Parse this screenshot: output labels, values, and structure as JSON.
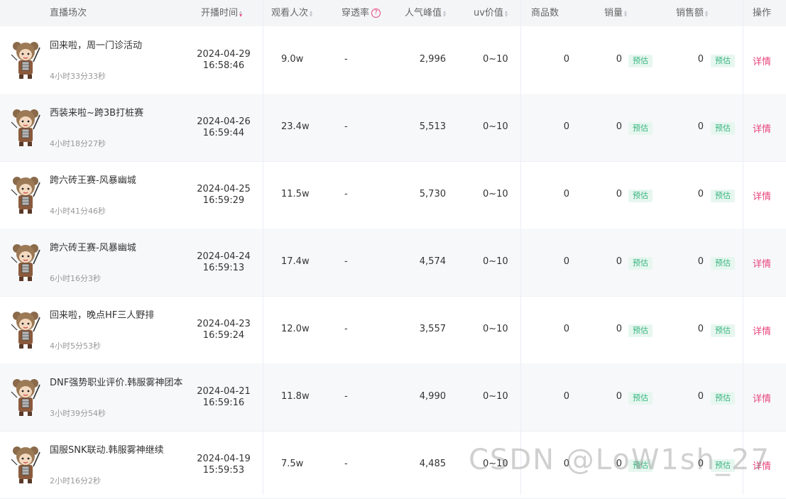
{
  "columns": {
    "session": "直播场次",
    "start_time": "开播时间",
    "viewers": "观看人次",
    "penetration": "穿透率",
    "peak": "人气峰值",
    "uv": "uv价值",
    "products": "商品数",
    "sales": "销量",
    "revenue": "销售额",
    "actions": "操作"
  },
  "help_glyph": "?",
  "estimate_label": "预估",
  "detail_label": "详情",
  "watermark": "CSDN @LoW1sh_27",
  "rows": [
    {
      "title": "回来啦，周一门诊活动",
      "duration": "4小时33分33秒",
      "date": "2024-04-29",
      "time": "16:58:46",
      "viewers": "9.0w",
      "penetration": "-",
      "peak": "2,996",
      "uv": "0~10",
      "products": "0",
      "sales": "0",
      "revenue": "0"
    },
    {
      "title": "西装来啦~跨3B打桩赛",
      "duration": "4小时18分27秒",
      "date": "2024-04-26",
      "time": "16:59:44",
      "viewers": "23.4w",
      "penetration": "-",
      "peak": "5,513",
      "uv": "0~10",
      "products": "0",
      "sales": "0",
      "revenue": "0"
    },
    {
      "title": "跨六砖王赛-风暴幽城",
      "duration": "4小时41分46秒",
      "date": "2024-04-25",
      "time": "16:59:29",
      "viewers": "11.5w",
      "penetration": "-",
      "peak": "5,730",
      "uv": "0~10",
      "products": "0",
      "sales": "0",
      "revenue": "0"
    },
    {
      "title": "跨六砖王赛-风暴幽城",
      "duration": "6小时16分3秒",
      "date": "2024-04-24",
      "time": "16:59:13",
      "viewers": "17.4w",
      "penetration": "-",
      "peak": "4,574",
      "uv": "0~10",
      "products": "0",
      "sales": "0",
      "revenue": "0"
    },
    {
      "title": "回来啦，晚点HF三人野排",
      "duration": "4小时5分53秒",
      "date": "2024-04-23",
      "time": "16:59:24",
      "viewers": "12.0w",
      "penetration": "-",
      "peak": "3,557",
      "uv": "0~10",
      "products": "0",
      "sales": "0",
      "revenue": "0"
    },
    {
      "title": "DNF强势职业评价.韩服雾神团本",
      "duration": "3小时39分54秒",
      "date": "2024-04-21",
      "time": "16:59:16",
      "viewers": "11.8w",
      "penetration": "-",
      "peak": "4,990",
      "uv": "0~10",
      "products": "0",
      "sales": "0",
      "revenue": "0"
    },
    {
      "title": "国服SNK联动.韩服雾神继续",
      "duration": "2小时16分2秒",
      "date": "2024-04-19",
      "time": "15:59:53",
      "viewers": "7.5w",
      "penetration": "-",
      "peak": "4,485",
      "uv": "0~10",
      "products": "0",
      "sales": "0",
      "revenue": "0"
    }
  ]
}
